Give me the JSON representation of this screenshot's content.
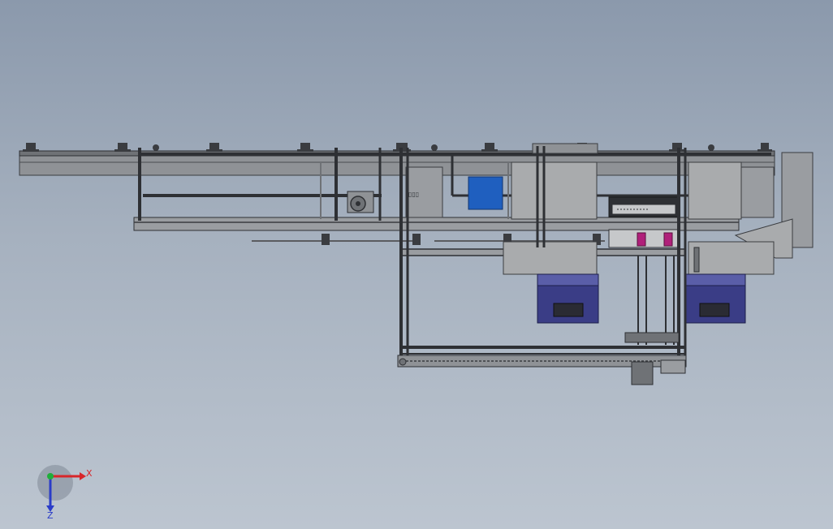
{
  "viewport": {
    "background_top": "#8b99ac",
    "background_bottom": "#bcc5d0"
  },
  "model": {
    "frame_color": "#2e3034",
    "rail_color": "#8f9296",
    "panel_color": "#a9abad",
    "accent_blue": "#1f5fbf",
    "accent_navy": "#3a3d86",
    "accent_magenta": "#b0207a"
  },
  "triad": {
    "x_label": "X",
    "z_label": "Z",
    "x_color": "#d8262a",
    "y_color": "#1fae3a",
    "z_color": "#2a3cc8"
  }
}
